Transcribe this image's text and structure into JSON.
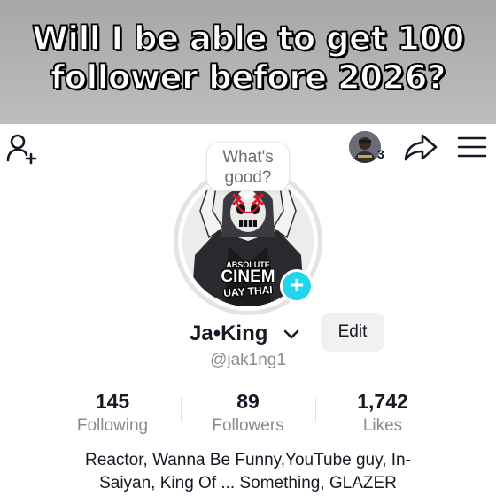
{
  "banner": {
    "caption_line1": "Will I be able to get 100",
    "caption_line2": "follower before 2026?"
  },
  "header": {
    "icons": [
      "add-user-icon",
      "avatar",
      "share-icon",
      "menu-icon"
    ],
    "notification_count": "3"
  },
  "profile": {
    "speech_bubble_line1": "What's",
    "speech_bubble_line2": "good?",
    "avatar_caption_top": "ABSOLUTE",
    "avatar_caption_main": "CINEM",
    "avatar_caption_bottom": "UAY THAI",
    "display_name": "Ja•King",
    "username": "@jak1ng1",
    "edit_label": "Edit",
    "follow_plus": "+"
  },
  "stats": {
    "following_count": "145",
    "following_label": "Following",
    "followers_count": "89",
    "followers_label": "Followers",
    "likes_count": "1,742",
    "likes_label": "Likes"
  },
  "bio": {
    "line1": "Reactor, Wanna Be Funny,YouTube guy, In-",
    "line2": "Saiyan, King Of ... Something, GLAZER"
  },
  "colors": {
    "accent_plus": "#20d5ec",
    "text_primary": "#161823",
    "text_secondary": "#8a8b91"
  }
}
